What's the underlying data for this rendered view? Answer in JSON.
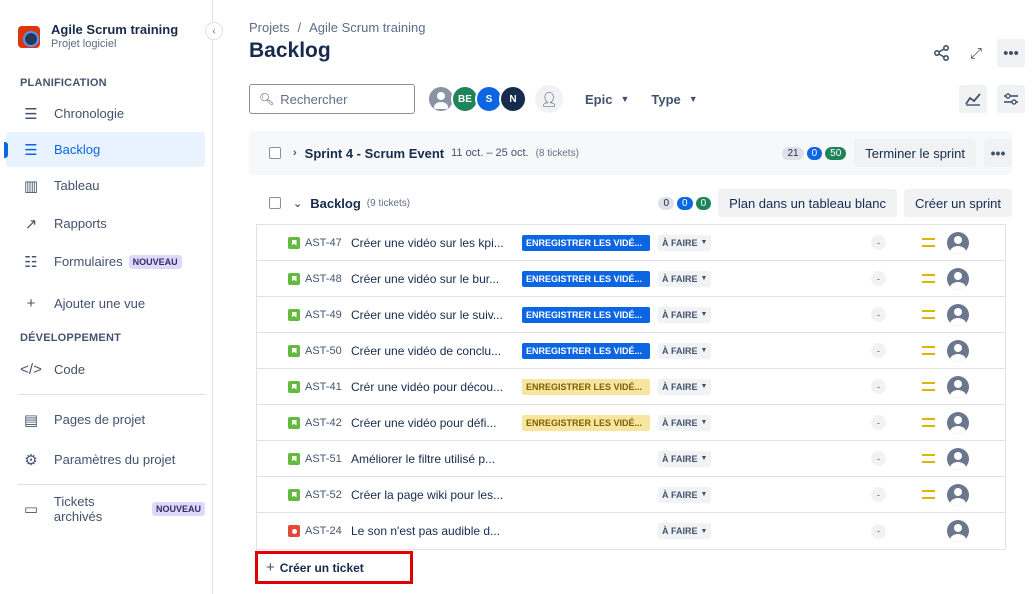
{
  "project": {
    "name": "Agile Scrum training",
    "type": "Projet logiciel"
  },
  "sidebar": {
    "planning_title": "PLANIFICATION",
    "planning_items": [
      {
        "label": "Chronologie",
        "icon": "timeline-icon"
      },
      {
        "label": "Backlog",
        "icon": "backlog-icon",
        "active": true
      },
      {
        "label": "Tableau",
        "icon": "board-icon"
      },
      {
        "label": "Rapports",
        "icon": "reports-icon"
      },
      {
        "label": "Formulaires",
        "icon": "forms-icon",
        "badge": "NOUVEAU"
      },
      {
        "label": "Ajouter une vue",
        "icon": "plus-icon"
      }
    ],
    "dev_title": "DÉVELOPPEMENT",
    "dev_items": [
      {
        "label": "Code",
        "icon": "code-icon"
      }
    ],
    "bottom_items": [
      {
        "label": "Pages de projet",
        "icon": "pages-icon"
      },
      {
        "label": "Paramètres du projet",
        "icon": "settings-icon"
      },
      {
        "label": "Tickets archivés",
        "icon": "archive-icon",
        "badge": "NOUVEAU"
      }
    ]
  },
  "breadcrumb": {
    "root": "Projets",
    "sep": "/",
    "project": "Agile Scrum training"
  },
  "page_title": "Backlog",
  "toolbar": {
    "search_placeholder": "Rechercher",
    "avatars": [
      "",
      "BE",
      "S",
      "N"
    ],
    "epic_label": "Epic",
    "type_label": "Type"
  },
  "sprint": {
    "name": "Sprint 4 - Scrum Event",
    "dates": "11 oct. – 25 oct.",
    "count": "(8 tickets)",
    "todo": "21",
    "inprog": "0",
    "done": "50",
    "finish_label": "Terminer le sprint"
  },
  "backlog": {
    "name": "Backlog",
    "count": "(9 tickets)",
    "todo": "0",
    "inprog": "0",
    "done": "0",
    "plan_label": "Plan dans un tableau blanc",
    "create_sprint_label": "Créer un sprint",
    "issues": [
      {
        "key": "AST-47",
        "summary": "Créer une vidéo sur les kpi...",
        "epic": "ENREGISTRER LES VIDÉ...",
        "epic_color": "blue",
        "status": "À FAIRE",
        "est": "-",
        "type": "story",
        "priority": "medium"
      },
      {
        "key": "AST-48",
        "summary": "Créer une vidéo sur le bur...",
        "epic": "ENREGISTRER LES VIDÉ...",
        "epic_color": "blue",
        "status": "À FAIRE",
        "est": "-",
        "type": "story",
        "priority": "medium"
      },
      {
        "key": "AST-49",
        "summary": "Créer une vidéo sur le suiv...",
        "epic": "ENREGISTRER LES VIDÉ...",
        "epic_color": "blue",
        "status": "À FAIRE",
        "est": "-",
        "type": "story",
        "priority": "medium"
      },
      {
        "key": "AST-50",
        "summary": "Créer une vidéo de conclu...",
        "epic": "ENREGISTRER LES VIDÉ...",
        "epic_color": "blue",
        "status": "À FAIRE",
        "est": "-",
        "type": "story",
        "priority": "medium"
      },
      {
        "key": "AST-41",
        "summary": "Crér une vidéo pour décou...",
        "epic": "ENREGISTRER LES VIDÉ...",
        "epic_color": "yellow",
        "status": "À FAIRE",
        "est": "-",
        "type": "story",
        "priority": "medium"
      },
      {
        "key": "AST-42",
        "summary": "Créer une vidéo pour défi...",
        "epic": "ENREGISTRER LES VIDÉ...",
        "epic_color": "yellow",
        "status": "À FAIRE",
        "est": "-",
        "type": "story",
        "priority": "medium"
      },
      {
        "key": "AST-51",
        "summary": "Améliorer le filtre utilisé p...",
        "epic": "",
        "epic_color": "",
        "status": "À FAIRE",
        "est": "-",
        "type": "story",
        "priority": "medium"
      },
      {
        "key": "AST-52",
        "summary": "Créer la page wiki pour les...",
        "epic": "",
        "epic_color": "",
        "status": "À FAIRE",
        "est": "-",
        "type": "story",
        "priority": "medium"
      },
      {
        "key": "AST-24",
        "summary": "Le son n'est pas audible d...",
        "epic": "",
        "epic_color": "",
        "status": "À FAIRE",
        "est": "-",
        "type": "bug",
        "priority": ""
      }
    ]
  },
  "create_ticket_label": "Créer un ticket"
}
